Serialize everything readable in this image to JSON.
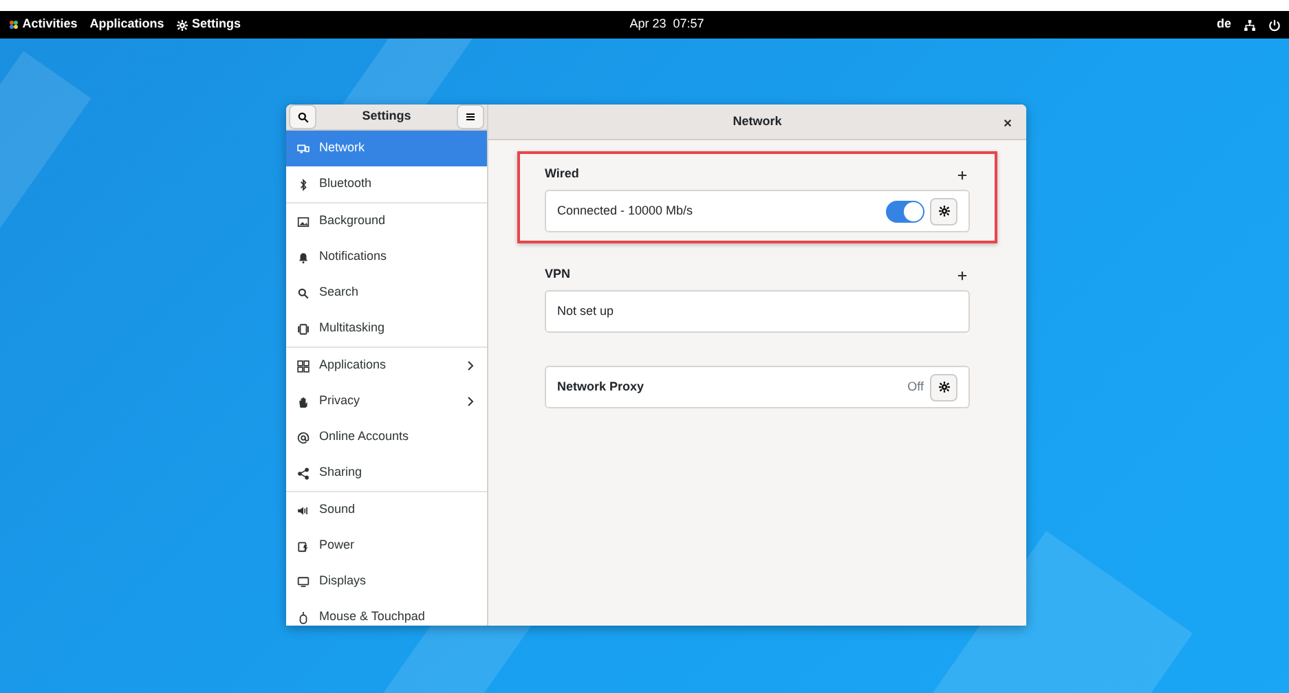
{
  "top_bar": {
    "activities": "Activities",
    "applications": "Applications",
    "app_menu": "Settings",
    "clock": "Apr 23  07:57",
    "keyboard_layout": "de"
  },
  "window": {
    "sidebar_title": "Settings",
    "content_title": "Network",
    "sidebar": {
      "groups": [
        {
          "items": [
            {
              "label": "Network",
              "selected": true,
              "submenu": false
            },
            {
              "label": "Bluetooth",
              "selected": false,
              "submenu": false
            }
          ]
        },
        {
          "items": [
            {
              "label": "Background",
              "selected": false,
              "submenu": false
            },
            {
              "label": "Notifications",
              "selected": false,
              "submenu": false
            },
            {
              "label": "Search",
              "selected": false,
              "submenu": false
            },
            {
              "label": "Multitasking",
              "selected": false,
              "submenu": false
            }
          ]
        },
        {
          "items": [
            {
              "label": "Applications",
              "selected": false,
              "submenu": true
            },
            {
              "label": "Privacy",
              "selected": false,
              "submenu": true
            },
            {
              "label": "Online Accounts",
              "selected": false,
              "submenu": false
            },
            {
              "label": "Sharing",
              "selected": false,
              "submenu": false
            }
          ]
        },
        {
          "items": [
            {
              "label": "Sound",
              "selected": false,
              "submenu": false
            },
            {
              "label": "Power",
              "selected": false,
              "submenu": false
            },
            {
              "label": "Displays",
              "selected": false,
              "submenu": false
            },
            {
              "label": "Mouse & Touchpad",
              "selected": false,
              "submenu": false
            }
          ]
        }
      ]
    },
    "sections": [
      {
        "title": "Wired",
        "addable": true,
        "highlighted": true,
        "rows": [
          {
            "kind": "switch",
            "label": "Connected - 10000 Mb/s",
            "on": true
          }
        ]
      },
      {
        "title": "VPN",
        "addable": true,
        "highlighted": false,
        "rows": [
          {
            "kind": "plain",
            "label": "Not set up"
          }
        ]
      },
      {
        "addable": false,
        "highlighted": false,
        "rows": [
          {
            "kind": "status",
            "label": "Network Proxy",
            "value": "Off"
          }
        ]
      }
    ]
  }
}
